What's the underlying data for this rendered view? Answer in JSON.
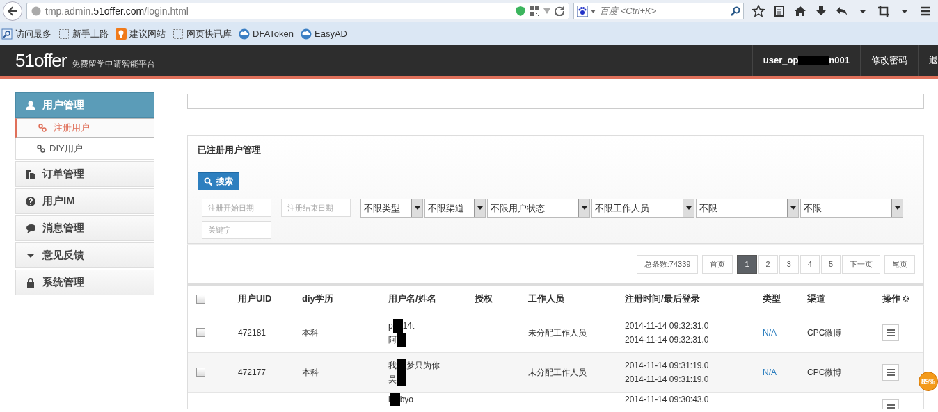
{
  "browser": {
    "url": "tmp.admin.**51offer.com**/login.html",
    "search_placeholder": "百度 <Ctrl+K>",
    "bookmarks": [
      {
        "label": "访问最多"
      },
      {
        "label": "新手上路"
      },
      {
        "label": "建议网站"
      },
      {
        "label": "网页快讯库"
      },
      {
        "label": "DFAToken"
      },
      {
        "label": "EasyAD"
      }
    ]
  },
  "header": {
    "logo": "51offer",
    "tagline": "免费留学申请智能平台",
    "user_before": "user_op",
    "user_after": "n001",
    "links": [
      "修改密码",
      "退"
    ]
  },
  "sidebar": [
    {
      "label": "用户管理",
      "expanded": true,
      "children": [
        {
          "label": "注册用户",
          "selected": true
        },
        {
          "label": "DIY用户",
          "selected": false
        }
      ]
    },
    {
      "label": "订单管理",
      "expanded": false
    },
    {
      "label": "用户IM",
      "expanded": false
    },
    {
      "label": "消息管理",
      "expanded": false
    },
    {
      "label": "意见反馈",
      "expanded": false
    },
    {
      "label": "系统管理",
      "expanded": false
    }
  ],
  "panel": {
    "title": "已注册用户管理",
    "search_button": "搜索",
    "filters": [
      {
        "kind": "text",
        "placeholder": "注册开始日期"
      },
      {
        "kind": "text",
        "placeholder": "注册结束日期"
      },
      {
        "kind": "select",
        "value": "不限类型"
      },
      {
        "kind": "select",
        "value": "不限渠道"
      },
      {
        "kind": "select",
        "value": "不限用户状态"
      },
      {
        "kind": "select",
        "value": "不限工作人员"
      },
      {
        "kind": "select",
        "value": "不限"
      },
      {
        "kind": "select",
        "value": "不限"
      },
      {
        "kind": "text",
        "placeholder": "关键字"
      }
    ]
  },
  "pagination": {
    "total": "总条数:74339",
    "pages": [
      {
        "label": "首页",
        "selected": false
      },
      {
        "label": "1",
        "selected": true
      },
      {
        "label": "2",
        "selected": false
      },
      {
        "label": "3",
        "selected": false
      },
      {
        "label": "4",
        "selected": false
      },
      {
        "label": "5",
        "selected": false
      },
      {
        "label": "下一页",
        "selected": false
      },
      {
        "label": "尾页",
        "selected": false
      }
    ]
  },
  "table": {
    "all_checked": false,
    "columns": [
      "用户UID",
      "diy学历",
      "用户名/姓名",
      "授权",
      "工作人员",
      "注册时间/最后登录",
      "类型",
      "渠道",
      "操作"
    ],
    "rows": [
      {
        "checked": false,
        "uid": "472181",
        "education": "本科",
        "name_lines": [
          {
            "before": "p",
            "after": "14t"
          },
          {
            "before": "阿"
          }
        ],
        "staff": "未分配工作人员",
        "times": [
          "2014-11-14 09:32:31.0",
          "2014-11-14 09:32:31.0"
        ],
        "type": "N/A",
        "channel": "CPC微博"
      },
      {
        "checked": false,
        "uid": "472177",
        "education": "本科",
        "name_lines": [
          {
            "before": "我",
            "after": "梦只为你"
          },
          {
            "before": "吴"
          }
        ],
        "staff": "未分配工作人员",
        "times": [
          "2014-11-14 09:31:19.0",
          "2014-11-14 09:31:19.0"
        ],
        "type": "N/A",
        "channel": "CPC微博"
      },
      {
        "name_lines": [
          {
            "before": "l",
            "after": "byo"
          }
        ],
        "times": [
          "2014-11-14 09:30:43.0"
        ]
      }
    ]
  },
  "badge": "89%"
}
